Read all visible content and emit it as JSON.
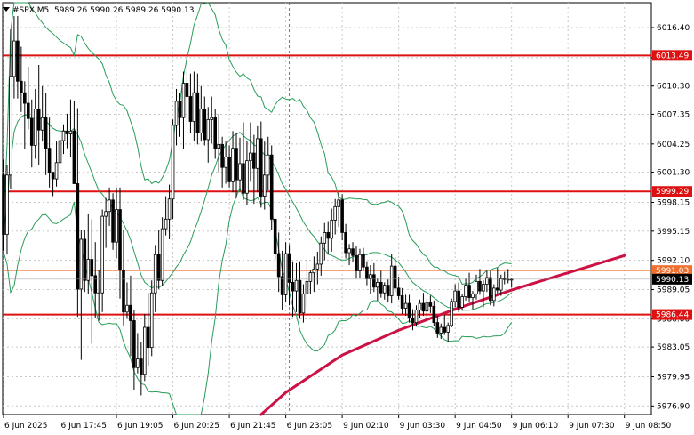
{
  "chart_data": {
    "type": "candlestick",
    "symbol": "#SPX,M5",
    "ohlc_header": "5989.26 5990.26 5989.26 5990.13",
    "ylim": [
      5976.0,
      6019.0
    ],
    "y_ticks": [
      "6016.40",
      "6013.25",
      "6010.30",
      "6007.35",
      "6004.25",
      "6001.30",
      "5998.15",
      "5995.15",
      "5992.10",
      "5989.05",
      "5986.00",
      "5983.05",
      "5979.95",
      "5976.90"
    ],
    "x_ticks": [
      "6 Jun 2025",
      "6 Jun 17:45",
      "6 Jun 19:05",
      "6 Jun 20:25",
      "6 Jun 21:45",
      "6 Jun 23:05",
      "9 Jun 02:10",
      "9 Jun 03:30",
      "9 Jun 04:50",
      "9 Jun 06:10",
      "9 Jun 07:30",
      "9 Jun 08:50"
    ],
    "x_tick_index": [
      0,
      16,
      32,
      48,
      64,
      80,
      96,
      112,
      128,
      144,
      160,
      176
    ],
    "separator_index": 81,
    "levels": [
      {
        "label": "6013.49",
        "value": 6013.49,
        "color": "#dd1111"
      },
      {
        "label": "5999.29",
        "value": 5999.29,
        "color": "#dd1111"
      },
      {
        "label": "5991.03",
        "value": 5991.03,
        "color": "#f07030"
      },
      {
        "label": "5986.44",
        "value": 5986.44,
        "color": "#dd1111"
      }
    ],
    "current_price": {
      "label": "5990.13",
      "value": 5990.13
    },
    "moving_average": {
      "color": "#cc1144",
      "points": [
        [
          73,
          5976.0
        ],
        [
          80,
          5978.3
        ],
        [
          96,
          5982.2
        ],
        [
          112,
          5984.8
        ],
        [
          128,
          5987.0
        ],
        [
          144,
          5989.0
        ],
        [
          160,
          5990.8
        ],
        [
          176,
          5992.6
        ]
      ]
    },
    "bollinger_color": "#2a9d5a",
    "candles": [
      [
        6001.0,
        6002.6,
        5993.1,
        5994.8
      ],
      [
        5994.8,
        6002.1,
        5992.7,
        6001.0
      ],
      [
        6001.0,
        6016.2,
        5999.5,
        6011.3
      ],
      [
        6011.3,
        6017.6,
        6009.0,
        6015.0
      ],
      [
        6015.0,
        6017.6,
        6009.0,
        6010.8
      ],
      [
        6010.8,
        6014.4,
        6007.6,
        6009.6
      ],
      [
        6009.6,
        6010.8,
        6003.7,
        6008.5
      ],
      [
        6008.5,
        6012.3,
        6005.8,
        6006.9
      ],
      [
        6006.9,
        6008.9,
        6001.8,
        6004.1
      ],
      [
        6004.1,
        6010.0,
        6002.7,
        6007.9
      ],
      [
        6007.9,
        6012.5,
        6002.1,
        6005.7
      ],
      [
        6005.7,
        6010.3,
        6004.5,
        6007.0
      ],
      [
        6007.0,
        6009.6,
        6001.0,
        6003.8
      ],
      [
        6003.8,
        6007.0,
        5999.7,
        6001.3
      ],
      [
        6001.3,
        6001.3,
        5998.8,
        6000.6
      ],
      [
        6000.6,
        6004.5,
        5999.8,
        6002.3
      ],
      [
        6002.3,
        6007.0,
        6000.9,
        6004.6
      ],
      [
        6004.6,
        6006.3,
        6003.2,
        6005.6
      ],
      [
        6005.6,
        6007.4,
        6003.8,
        6005.3
      ],
      [
        6005.3,
        6008.9,
        6002.9,
        6005.6
      ],
      [
        6005.6,
        6008.7,
        6000.1,
        6000.1
      ],
      [
        6000.1,
        6008.0,
        5986.2,
        5989.1
      ],
      [
        5989.1,
        5995.3,
        5981.7,
        5994.3
      ],
      [
        5994.3,
        5995.3,
        5988.8,
        5990.0
      ],
      [
        5990.0,
        5996.9,
        5988.6,
        5992.2
      ],
      [
        5992.2,
        5996.4,
        5983.4,
        5990.5
      ],
      [
        5990.5,
        5994.0,
        5986.1,
        5988.7
      ],
      [
        5988.7,
        5991.1,
        5985.8,
        5988.7
      ],
      [
        5988.7,
        5997.4,
        5986.7,
        5996.7
      ],
      [
        5996.7,
        5998.6,
        5993.4,
        5997.2
      ],
      [
        5997.2,
        5999.7,
        5995.7,
        5998.4
      ],
      [
        5998.4,
        5999.1,
        5993.2,
        5994.0
      ],
      [
        5994.0,
        5999.7,
        5992.3,
        5997.4
      ],
      [
        5997.4,
        5999.7,
        5988.1,
        5991.1
      ],
      [
        5991.1,
        5995.3,
        5985.3,
        5986.7
      ],
      [
        5986.7,
        5989.8,
        5986.0,
        5987.4
      ],
      [
        5987.4,
        5990.5,
        5982.1,
        5985.8
      ],
      [
        5985.8,
        5986.9,
        5978.6,
        5980.9
      ],
      [
        5980.9,
        5984.5,
        5980.3,
        5981.8
      ],
      [
        5981.8,
        5983.6,
        5978.0,
        5980.2
      ],
      [
        5980.2,
        5986.5,
        5979.5,
        5985.1
      ],
      [
        5985.1,
        5988.7,
        5981.1,
        5983.0
      ],
      [
        5983.0,
        5990.0,
        5982.1,
        5988.7
      ],
      [
        5988.7,
        5993.7,
        5986.7,
        5992.7
      ],
      [
        5992.7,
        5995.3,
        5989.1,
        5990.0
      ],
      [
        5990.0,
        5996.6,
        5989.4,
        5995.4
      ],
      [
        5995.4,
        5998.8,
        5994.7,
        5996.4
      ],
      [
        5996.4,
        6000.0,
        5994.3,
        5998.5
      ],
      [
        5998.5,
        6006.8,
        5996.4,
        6006.2
      ],
      [
        6006.2,
        6010.0,
        6004.1,
        6008.7
      ],
      [
        6008.7,
        6009.6,
        6005.0,
        6007.0
      ],
      [
        6007.0,
        6011.8,
        6003.7,
        6010.6
      ],
      [
        6010.6,
        6013.6,
        6006.0,
        6009.2
      ],
      [
        6009.2,
        6011.6,
        6005.4,
        6006.6
      ],
      [
        6006.6,
        6011.8,
        6004.6,
        6009.6
      ],
      [
        6009.6,
        6011.6,
        6004.2,
        6005.4
      ],
      [
        6005.4,
        6010.3,
        6004.5,
        6007.9
      ],
      [
        6007.9,
        6009.2,
        6004.1,
        6004.7
      ],
      [
        6004.7,
        6008.1,
        6002.3,
        6006.8
      ],
      [
        6006.8,
        6009.2,
        6004.3,
        6007.0
      ],
      [
        6007.0,
        6007.9,
        6002.7,
        6003.8
      ],
      [
        6003.8,
        6007.4,
        6001.3,
        6004.2
      ],
      [
        6004.2,
        6005.0,
        5999.7,
        6001.8
      ],
      [
        6001.8,
        6004.5,
        6000.1,
        6002.9
      ],
      [
        6002.9,
        6004.1,
        5999.7,
        6000.3
      ],
      [
        6000.3,
        6005.6,
        5999.2,
        6003.8
      ],
      [
        6003.8,
        6005.4,
        5998.6,
        6000.5
      ],
      [
        6000.5,
        6004.9,
        5999.4,
        6002.2
      ],
      [
        6002.2,
        6006.5,
        5998.4,
        5999.1
      ],
      [
        5999.1,
        6004.6,
        5997.9,
        6002.5
      ],
      [
        6002.5,
        6006.5,
        6000.3,
        6003.3
      ],
      [
        6003.3,
        6005.2,
        5998.0,
        6001.7
      ],
      [
        6001.7,
        6006.1,
        5999.2,
        6004.8
      ],
      [
        6004.8,
        6006.6,
        5997.6,
        5998.8
      ],
      [
        5998.8,
        6004.5,
        5997.4,
        6001.0
      ],
      [
        6001.0,
        6005.0,
        5999.4,
        6003.1
      ],
      [
        6003.1,
        6004.1,
        5995.3,
        5996.4
      ],
      [
        5996.4,
        5996.4,
        5992.2,
        5992.8
      ],
      [
        5992.8,
        5995.0,
        5988.8,
        5990.4
      ],
      [
        5990.4,
        5993.1,
        5986.9,
        5988.5
      ],
      [
        5988.5,
        5994.0,
        5987.7,
        5992.8
      ],
      [
        5992.8,
        5993.7,
        5987.4,
        5989.8
      ],
      [
        5989.8,
        5992.0,
        5986.2,
        5988.9
      ],
      [
        5988.9,
        5991.8,
        5986.7,
        5990.0
      ],
      [
        5990.0,
        5992.0,
        5986.0,
        5986.6
      ],
      [
        5986.6,
        5989.6,
        5985.6,
        5988.6
      ],
      [
        5988.6,
        5992.2,
        5987.2,
        5989.9
      ],
      [
        5989.9,
        5991.0,
        5988.6,
        5990.8
      ],
      [
        5990.8,
        5992.5,
        5988.8,
        5991.2
      ],
      [
        5991.2,
        5993.0,
        5989.6,
        5991.7
      ],
      [
        5991.7,
        5994.6,
        5990.5,
        5993.9
      ],
      [
        5993.9,
        5996.0,
        5992.1,
        5995.0
      ],
      [
        5995.0,
        5996.2,
        5992.8,
        5994.4
      ],
      [
        5994.4,
        5997.5,
        5993.0,
        5996.3
      ],
      [
        5996.3,
        5998.5,
        5994.8,
        5997.7
      ],
      [
        5997.7,
        5999.2,
        5995.6,
        5998.4
      ],
      [
        5998.4,
        5999.0,
        5994.2,
        5995.0
      ],
      [
        5995.0,
        5995.9,
        5992.3,
        5992.9
      ],
      [
        5992.9,
        5993.8,
        5991.6,
        5993.3
      ],
      [
        5993.3,
        5994.0,
        5991.9,
        5992.6
      ],
      [
        5992.6,
        5993.6,
        5990.2,
        5991.0
      ],
      [
        5991.0,
        5993.3,
        5990.3,
        5992.7
      ],
      [
        5992.7,
        5993.4,
        5991.0,
        5991.4
      ],
      [
        5991.4,
        5992.0,
        5989.5,
        5990.2
      ],
      [
        5990.2,
        5991.6,
        5988.6,
        5990.6
      ],
      [
        5990.6,
        5991.8,
        5988.8,
        5989.3
      ],
      [
        5989.3,
        5990.2,
        5987.9,
        5989.8
      ],
      [
        5989.8,
        5991.0,
        5988.2,
        5988.7
      ],
      [
        5988.7,
        5989.8,
        5988.0,
        5989.5
      ],
      [
        5989.5,
        5990.1,
        5987.7,
        5988.4
      ],
      [
        5988.4,
        5992.8,
        5987.6,
        5991.5
      ],
      [
        5991.5,
        5992.4,
        5988.8,
        5989.2
      ],
      [
        5989.2,
        5990.4,
        5988.0,
        5988.4
      ],
      [
        5988.4,
        5989.2,
        5986.5,
        5987.1
      ],
      [
        5987.1,
        5988.5,
        5986.3,
        5987.6
      ],
      [
        5987.6,
        5988.5,
        5985.6,
        5986.1
      ],
      [
        5986.1,
        5987.0,
        5984.8,
        5985.6
      ],
      [
        5985.6,
        5987.4,
        5985.2,
        5986.9
      ],
      [
        5986.9,
        5988.0,
        5986.1,
        5987.6
      ],
      [
        5987.6,
        5988.7,
        5986.3,
        5986.8
      ],
      [
        5986.8,
        5988.1,
        5985.8,
        5987.7
      ],
      [
        5987.7,
        5988.4,
        5986.6,
        5987.3
      ],
      [
        5987.3,
        5987.9,
        5985.2,
        5985.6
      ],
      [
        5985.6,
        5986.3,
        5984.0,
        5984.5
      ],
      [
        5984.5,
        5985.5,
        5983.9,
        5985.1
      ],
      [
        5985.1,
        5986.4,
        5984.3,
        5984.6
      ],
      [
        5984.6,
        5985.6,
        5983.6,
        5985.3
      ],
      [
        5985.3,
        5988.1,
        5985.1,
        5987.8
      ],
      [
        5987.8,
        5989.6,
        5987.2,
        5988.9
      ],
      [
        5988.9,
        5989.8,
        5986.7,
        5987.2
      ],
      [
        5987.2,
        5988.6,
        5986.9,
        5988.3
      ],
      [
        5988.3,
        5990.2,
        5987.9,
        5989.5
      ],
      [
        5989.5,
        5990.8,
        5987.8,
        5988.2
      ],
      [
        5988.2,
        5988.9,
        5987.0,
        5988.6
      ],
      [
        5988.6,
        5990.6,
        5988.0,
        5989.9
      ],
      [
        5989.9,
        5991.2,
        5988.5,
        5988.9
      ],
      [
        5988.9,
        5990.0,
        5987.2,
        5989.6
      ],
      [
        5989.6,
        5991.0,
        5988.8,
        5990.3
      ],
      [
        5990.3,
        5991.0,
        5987.4,
        5987.9
      ],
      [
        5987.9,
        5989.6,
        5987.3,
        5989.2
      ],
      [
        5989.2,
        5991.3,
        5988.6,
        5989.0
      ],
      [
        5989.0,
        5990.6,
        5988.4,
        5990.2
      ],
      [
        5990.2,
        5990.9,
        5989.6,
        5990.1
      ],
      [
        5990.1,
        5991.2,
        5989.7,
        5990.13
      ],
      [
        5990.13,
        5990.26,
        5989.26,
        5990.13
      ]
    ]
  }
}
